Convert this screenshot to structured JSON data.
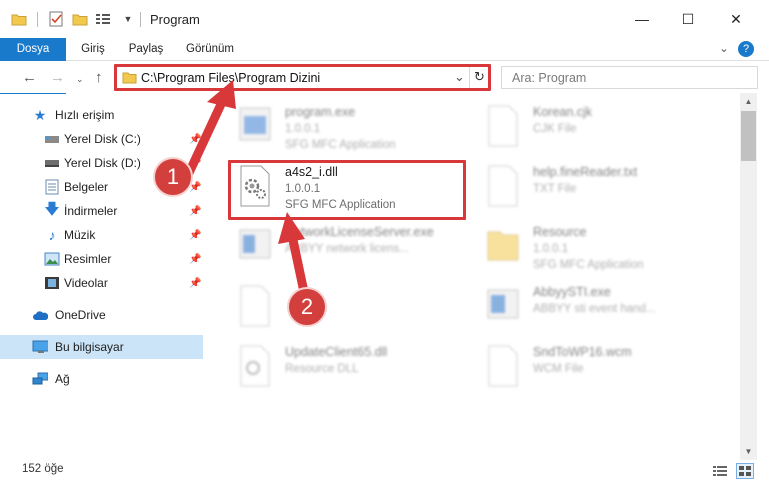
{
  "window": {
    "title": "Program",
    "minimize": "—",
    "maximize": "☐",
    "close": "✕"
  },
  "ribbon": {
    "tabs": [
      "Dosya",
      "Giriş",
      "Paylaş",
      "Görünüm"
    ],
    "expand": "⌄",
    "help": "?"
  },
  "address": {
    "path": "C:\\Program Files\\Program Dizini",
    "dropdown": "⌄",
    "refresh": "↻"
  },
  "search": {
    "placeholder": "Ara: Program"
  },
  "sidebar": {
    "items": [
      {
        "label": "Hızlı erişim",
        "icon": "star-icon"
      },
      {
        "label": "Yerel Disk (C:)",
        "icon": "drive-icon"
      },
      {
        "label": "Yerel Disk (D:)",
        "icon": "drive-icon"
      },
      {
        "label": "Belgeler",
        "icon": "documents-icon"
      },
      {
        "label": "İndirmeler",
        "icon": "downloads-icon"
      },
      {
        "label": "Müzik",
        "icon": "music-icon"
      },
      {
        "label": "Resimler",
        "icon": "pictures-icon"
      },
      {
        "label": "Videolar",
        "icon": "videos-icon"
      },
      {
        "label": "OneDrive",
        "icon": "cloud-icon"
      },
      {
        "label": "Bu bilgisayar",
        "icon": "computer-icon"
      },
      {
        "label": "Ağ",
        "icon": "network-icon"
      }
    ]
  },
  "files": [
    {
      "name": "program.exe",
      "line1": "1.0.0.1",
      "line2": "SFG MFC Application"
    },
    {
      "name": "Korean.cjk",
      "line1": "CJK File",
      "line2": ""
    },
    {
      "name": "a4s2_i.dll",
      "line1": "1.0.0.1",
      "line2": "SFG MFC Application"
    },
    {
      "name": "help.fineReader.txt",
      "line1": "TXT File",
      "line2": ""
    },
    {
      "name": "NetworkLicenseServer.exe",
      "line1": "ABBYY network licens...",
      "line2": ""
    },
    {
      "name": "Resource",
      "line1": "1.0.0.1",
      "line2": "SFG MFC Application"
    },
    {
      "name": "AbbyySTI.exe",
      "line1": "ABBYY sti event hand...",
      "line2": ""
    },
    {
      "name": "UpdateClient65.dll",
      "line1": "Resource DLL",
      "line2": ""
    },
    {
      "name": "SndToWP16.wcm",
      "line1": "WCM File",
      "line2": ""
    }
  ],
  "status": {
    "count": "152 öğe"
  },
  "callouts": [
    "1",
    "2"
  ],
  "colors": {
    "accent": "#1979ca",
    "highlight_red": "#d9383a",
    "selected_nav": "#cce4f7"
  }
}
